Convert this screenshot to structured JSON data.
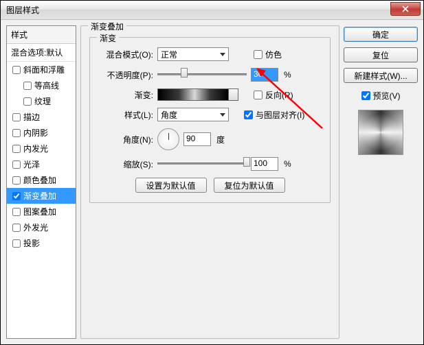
{
  "title": "图层样式",
  "left": {
    "header": "样式",
    "sub": "混合选项:默认",
    "items": [
      {
        "label": "斜面和浮雕",
        "checked": false
      },
      {
        "label": "等高线",
        "checked": false,
        "indent": true
      },
      {
        "label": "纹理",
        "checked": false,
        "indent": true
      },
      {
        "label": "描边",
        "checked": false
      },
      {
        "label": "内阴影",
        "checked": false
      },
      {
        "label": "内发光",
        "checked": false
      },
      {
        "label": "光泽",
        "checked": false
      },
      {
        "label": "颜色叠加",
        "checked": false
      },
      {
        "label": "渐变叠加",
        "checked": true,
        "selected": true
      },
      {
        "label": "图案叠加",
        "checked": false
      },
      {
        "label": "外发光",
        "checked": false
      },
      {
        "label": "投影",
        "checked": false
      }
    ]
  },
  "group": {
    "outer_legend": "渐变叠加",
    "inner_legend": "渐变",
    "blend_label": "混合模式(O):",
    "blend_value": "正常",
    "dither_label": "仿色",
    "dither_checked": false,
    "opacity_label": "不透明度(P):",
    "opacity_value": "30",
    "percent": "%",
    "gradient_label": "渐变:",
    "reverse_label": "反向(R)",
    "reverse_checked": false,
    "style_label": "样式(L):",
    "style_value": "角度",
    "align_label": "与图层对齐(I)",
    "align_checked": true,
    "angle_label": "角度(N):",
    "angle_value": "90",
    "angle_unit": "度",
    "scale_label": "缩放(S):",
    "scale_value": "100",
    "btn_default": "设置为默认值",
    "btn_reset": "复位为默认值"
  },
  "right": {
    "ok": "确定",
    "cancel": "复位",
    "newstyle": "新建样式(W)...",
    "preview_label": "预览(V)",
    "preview_checked": true
  }
}
